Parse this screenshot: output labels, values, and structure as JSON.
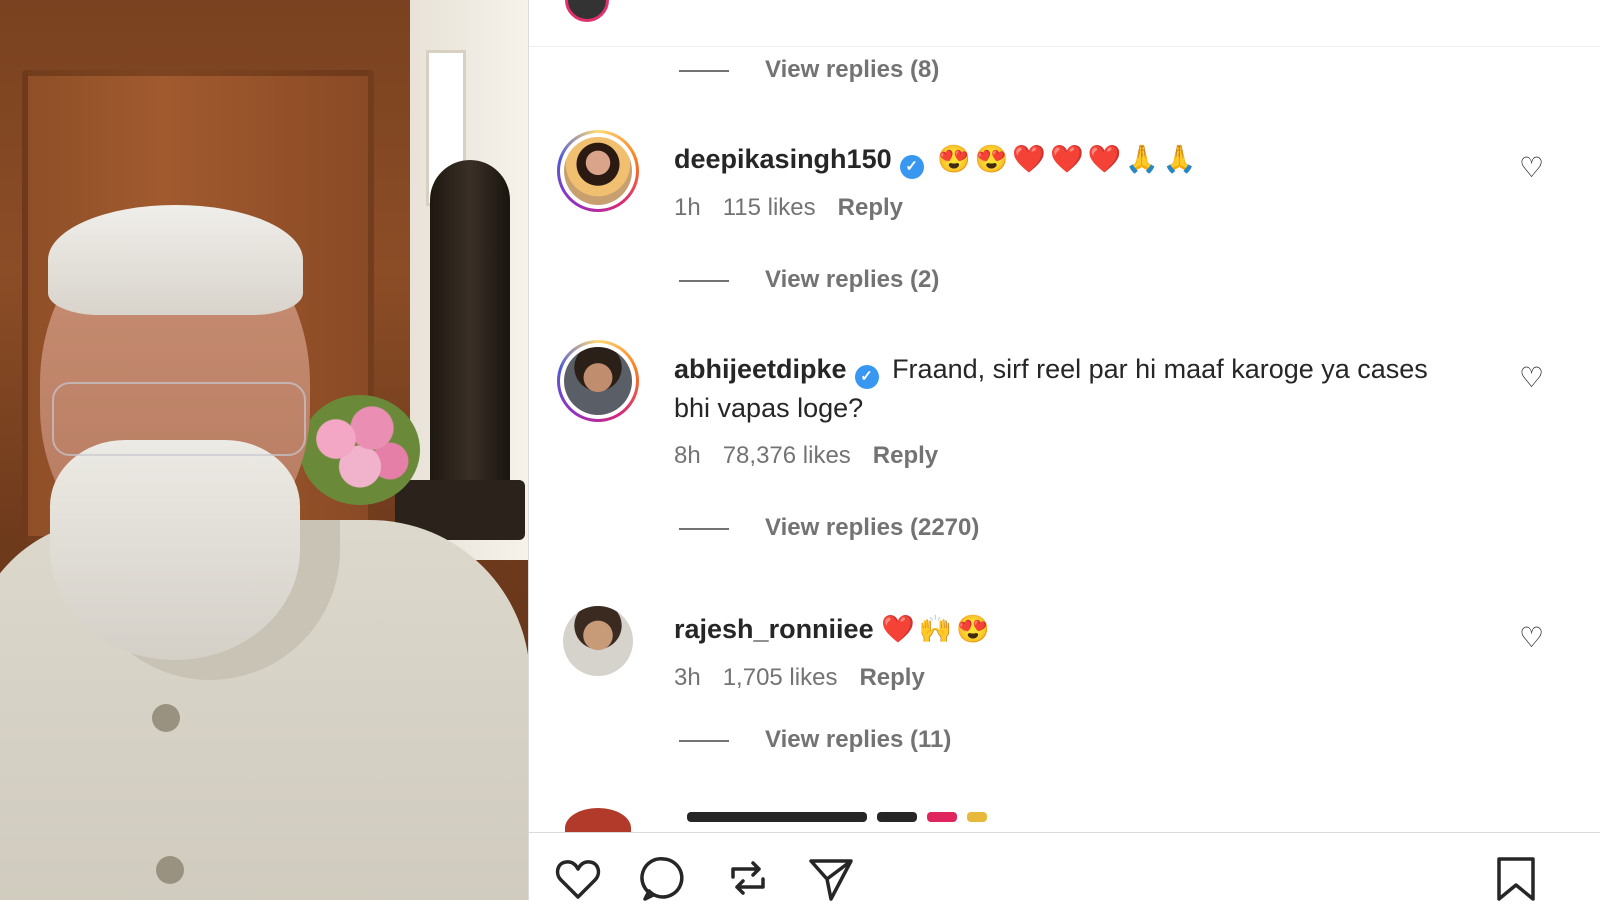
{
  "comments": [
    {
      "username": "deepikasingh150",
      "verified": true,
      "text": "😍😍❤️❤️❤️🙏🙏",
      "time": "1h",
      "likes": "115 likes",
      "reply_label": "Reply",
      "view_replies": "View replies (2)"
    },
    {
      "username": "abhijeetdipke",
      "verified": true,
      "text": "Fraand, sirf reel par hi maaf karoge ya cases bhi vapas loge?",
      "time": "8h",
      "likes": "78,376 likes",
      "reply_label": "Reply",
      "view_replies": "View replies (2270)"
    },
    {
      "username": "rajesh_ronniiee",
      "verified": false,
      "text": "❤️🙌😍",
      "time": "3h",
      "likes": "1,705 likes",
      "reply_label": "Reply",
      "view_replies": "View replies (11)"
    }
  ],
  "previous_view_replies": "View replies (8)",
  "icons": {
    "like": "heart-icon",
    "comment": "comment-icon",
    "repost": "repost-icon",
    "share": "share-icon",
    "save": "bookmark-icon"
  },
  "colors": {
    "text": "#262626",
    "muted": "#737373",
    "verified": "#3897f0",
    "divider": "#dbdbdb"
  }
}
